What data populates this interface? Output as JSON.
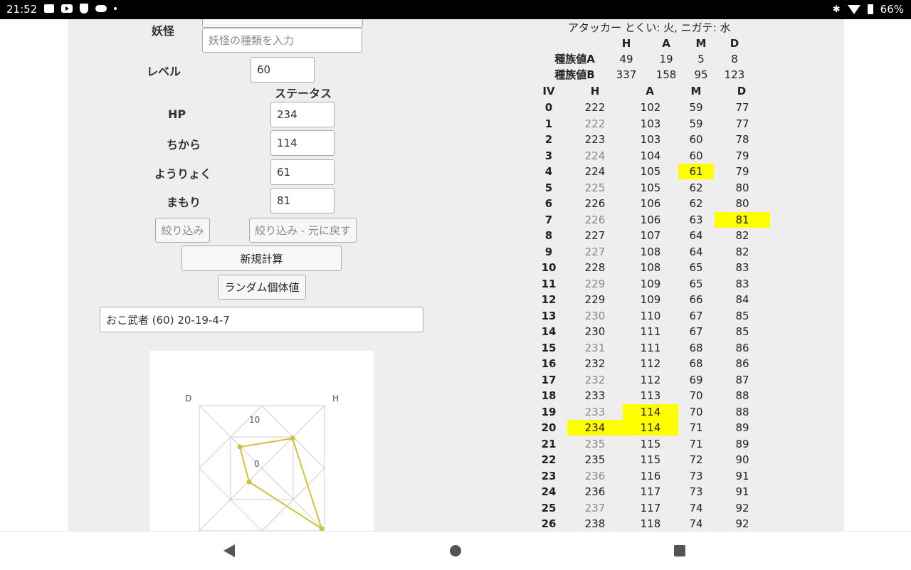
{
  "status_bar": {
    "time": "21:52",
    "battery": "66%"
  },
  "form": {
    "yokai_label": "妖怪",
    "yokai_placeholder": "妖怪の種類を入力",
    "level_label": "レベル",
    "level_value": "60",
    "status_header": "ステータス",
    "stats": [
      {
        "label": "HP",
        "value": "234"
      },
      {
        "label": "ちから",
        "value": "114"
      },
      {
        "label": "ようりょく",
        "value": "61"
      },
      {
        "label": "まもり",
        "value": "81"
      }
    ],
    "filter_button": "絞り込み",
    "filter_reset_button": "絞り込み - 元に戻す",
    "new_calc_button": "新規計算",
    "random_iv_button": "ランダム個体値",
    "result_text": "おこ武者 (60) 20-19-4-7"
  },
  "radar": {
    "labels": [
      "D",
      "H"
    ],
    "ring_labels": [
      "10",
      "0"
    ],
    "color": "#d4c03a"
  },
  "stats_table": {
    "type_line": "アタッカー とくい: 火, ニガテ: 水",
    "col_heads": [
      "H",
      "A",
      "M",
      "D"
    ],
    "base_a": {
      "label": "種族値A",
      "values": [
        "49",
        "19",
        "5",
        "8"
      ]
    },
    "base_b": {
      "label": "種族値B",
      "values": [
        "337",
        "158",
        "95",
        "123"
      ]
    },
    "headers": [
      "IV",
      "H",
      "A",
      "M",
      "D"
    ],
    "highlight_color": "#ffff00",
    "rows": [
      {
        "iv": "0",
        "h": "222",
        "a": "102",
        "m": "59",
        "d": "77"
      },
      {
        "iv": "1",
        "h": "222",
        "a": "103",
        "m": "59",
        "d": "77"
      },
      {
        "iv": "2",
        "h": "223",
        "a": "103",
        "m": "60",
        "d": "78"
      },
      {
        "iv": "3",
        "h": "224",
        "a": "104",
        "m": "60",
        "d": "79"
      },
      {
        "iv": "4",
        "h": "224",
        "a": "105",
        "m": "61",
        "d": "79"
      },
      {
        "iv": "5",
        "h": "225",
        "a": "105",
        "m": "62",
        "d": "80"
      },
      {
        "iv": "6",
        "h": "226",
        "a": "106",
        "m": "62",
        "d": "80"
      },
      {
        "iv": "7",
        "h": "226",
        "a": "106",
        "m": "63",
        "d": "81"
      },
      {
        "iv": "8",
        "h": "227",
        "a": "107",
        "m": "64",
        "d": "82"
      },
      {
        "iv": "9",
        "h": "227",
        "a": "108",
        "m": "64",
        "d": "82"
      },
      {
        "iv": "10",
        "h": "228",
        "a": "108",
        "m": "65",
        "d": "83"
      },
      {
        "iv": "11",
        "h": "229",
        "a": "109",
        "m": "65",
        "d": "83"
      },
      {
        "iv": "12",
        "h": "229",
        "a": "109",
        "m": "66",
        "d": "84"
      },
      {
        "iv": "13",
        "h": "230",
        "a": "110",
        "m": "67",
        "d": "85"
      },
      {
        "iv": "14",
        "h": "230",
        "a": "111",
        "m": "67",
        "d": "85"
      },
      {
        "iv": "15",
        "h": "231",
        "a": "111",
        "m": "68",
        "d": "86"
      },
      {
        "iv": "16",
        "h": "232",
        "a": "112",
        "m": "68",
        "d": "86"
      },
      {
        "iv": "17",
        "h": "232",
        "a": "112",
        "m": "69",
        "d": "87"
      },
      {
        "iv": "18",
        "h": "233",
        "a": "113",
        "m": "70",
        "d": "88"
      },
      {
        "iv": "19",
        "h": "233",
        "a": "114",
        "m": "70",
        "d": "88"
      },
      {
        "iv": "20",
        "h": "234",
        "a": "114",
        "m": "71",
        "d": "89"
      },
      {
        "iv": "21",
        "h": "235",
        "a": "115",
        "m": "71",
        "d": "89"
      },
      {
        "iv": "22",
        "h": "235",
        "a": "115",
        "m": "72",
        "d": "90"
      },
      {
        "iv": "23",
        "h": "236",
        "a": "116",
        "m": "73",
        "d": "91"
      },
      {
        "iv": "24",
        "h": "236",
        "a": "117",
        "m": "73",
        "d": "91"
      },
      {
        "iv": "25",
        "h": "237",
        "a": "117",
        "m": "74",
        "d": "92"
      },
      {
        "iv": "26",
        "h": "238",
        "a": "118",
        "m": "74",
        "d": "92"
      }
    ],
    "muted_h_rows": [
      "1",
      "3",
      "5",
      "7",
      "9",
      "11",
      "13",
      "15",
      "17",
      "19",
      "21",
      "23",
      "25"
    ],
    "highlights": [
      {
        "iv": "4",
        "col": "m"
      },
      {
        "iv": "7",
        "col": "d"
      },
      {
        "iv": "19",
        "col": "a"
      },
      {
        "iv": "20",
        "col": "h"
      },
      {
        "iv": "20",
        "col": "a"
      }
    ]
  },
  "nav_bar": {
    "icons": [
      "back-icon",
      "home-icon",
      "recents-icon"
    ]
  }
}
